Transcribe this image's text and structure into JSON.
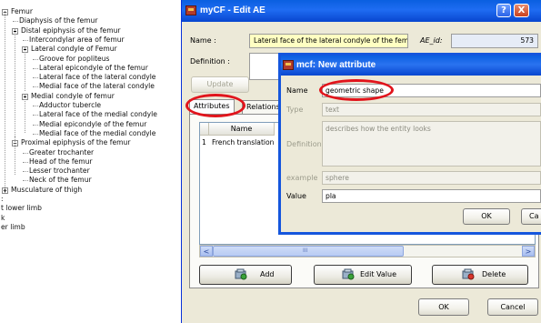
{
  "tree": {
    "items": [
      {
        "label": "Femur",
        "level": 0,
        "box": "minus"
      },
      {
        "label": "Diaphysis of the femur",
        "level": 1
      },
      {
        "label": "Distal epiphysis of the femur",
        "level": 1,
        "box": "minus"
      },
      {
        "label": "Intercondylar area of femur",
        "level": 2
      },
      {
        "label": "Lateral condyle of Femur",
        "level": 2,
        "box": "minus"
      },
      {
        "label": "Groove for popliteus",
        "level": 3
      },
      {
        "label": "Lateral epicondyle of the femur",
        "level": 3
      },
      {
        "label": "Lateral face of the lateral condyle",
        "level": 3
      },
      {
        "label": "Medial face of the lateral condyle",
        "level": 3
      },
      {
        "label": "Medial condyle of femur",
        "level": 2,
        "box": "minus"
      },
      {
        "label": "Adductor tubercle",
        "level": 3
      },
      {
        "label": "Lateral face of the medial condyle",
        "level": 3
      },
      {
        "label": "Medial epicondyle of the femur",
        "level": 3
      },
      {
        "label": "Medial face of the medial condyle",
        "level": 3
      },
      {
        "label": "Proximal epiphysis of the femur",
        "level": 1,
        "box": "minus"
      },
      {
        "label": "Greater trochanter",
        "level": 2
      },
      {
        "label": "Head of the femur",
        "level": 2
      },
      {
        "label": "Lesser trochanter",
        "level": 2
      },
      {
        "label": "Neck of the femur",
        "level": 2
      },
      {
        "label": "Musculature of thigh",
        "level": 0,
        "box": "plus"
      },
      {
        "label": ":",
        "level": -1
      },
      {
        "label": "t lower limb",
        "level": -1
      },
      {
        "label": "k",
        "level": -1
      },
      {
        "label": "er limb",
        "level": -1
      }
    ]
  },
  "main_window": {
    "title": "myCF - Edit AE",
    "help_button": "?",
    "close_button": "X",
    "name_label": "Name :",
    "name_value": "Lateral face of the lateral condyle of the femur",
    "ae_id_label": "AE_id:",
    "ae_id_value": "573",
    "definition_label": "Definition :",
    "update_button": "Update",
    "tabs": [
      "Attributes",
      "Relations"
    ],
    "grid": {
      "columns": [
        "Name"
      ],
      "rows": [
        {
          "num": "1",
          "name": "French translation"
        }
      ]
    },
    "scroll_left": "<",
    "scroll_right": ">",
    "scroll_mid": "III",
    "add_button": "Add",
    "edit_value_button": "Edit Value",
    "delete_button": "Delete",
    "ok_button": "OK",
    "cancel_button": "Cancel"
  },
  "dialog": {
    "title": "mcf: New attribute",
    "fields": {
      "name_label": "Name",
      "name_value": "geometric shape",
      "type_label": "Type",
      "type_value": "text",
      "definition_label": "Definition",
      "definition_value": "describes how the entity looks",
      "example_label": "example",
      "example_value": "sphere",
      "value_label": "Value",
      "value_value": "pla"
    },
    "ok_button": "OK",
    "cancel_button": "Ca"
  },
  "colors": {
    "title_bar": "#0a5fe0",
    "window_bg": "#ece9d8",
    "name_field_bg": "#ffffc2",
    "highlight_ellipse": "#e1141c"
  }
}
